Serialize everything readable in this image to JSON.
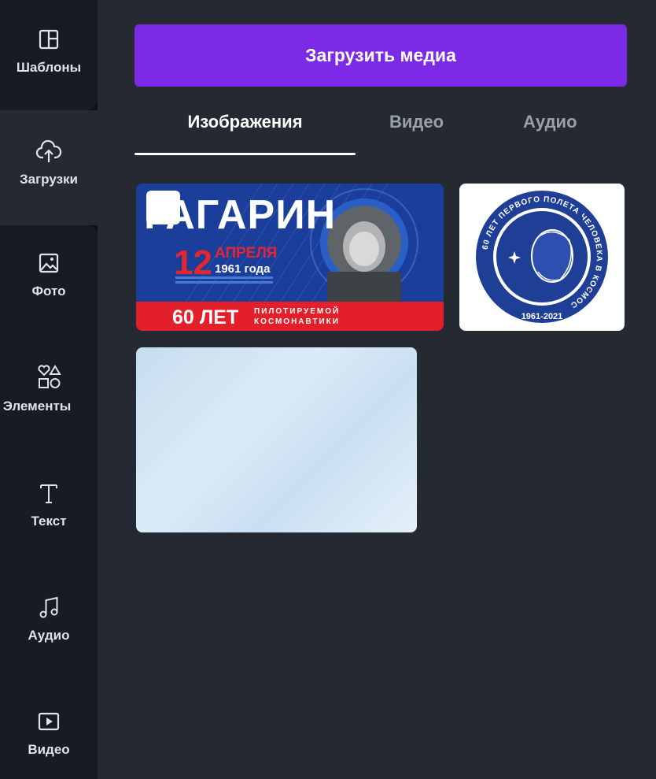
{
  "sidebar": {
    "items": [
      {
        "label": "Шаблоны",
        "icon": "layout-icon"
      },
      {
        "label": "Загрузки",
        "icon": "cloud-upload-icon"
      },
      {
        "label": "Фото",
        "icon": "image-icon"
      },
      {
        "label": "Элементы",
        "icon": "shapes-icon"
      },
      {
        "label": "Текст",
        "icon": "text-icon"
      },
      {
        "label": "Аудио",
        "icon": "music-note-icon"
      },
      {
        "label": "Видео",
        "icon": "video-play-icon"
      }
    ]
  },
  "panel": {
    "upload_button": "Загрузить медиа",
    "tabs": [
      {
        "label": "Изображения",
        "active": true
      },
      {
        "label": "Видео",
        "active": false
      },
      {
        "label": "Аудио",
        "active": false
      }
    ]
  },
  "thumbnails": {
    "poster": {
      "title": "ГАГАРИН",
      "day": "12",
      "month": "АПРЕЛЯ",
      "year": "1961 года",
      "years_label": "60 ЛЕТ",
      "subtitle_line1": "ПИЛОТИРУЕМОЙ",
      "subtitle_line2": "КОСМОНАВТИКИ"
    },
    "emblem": {
      "ring_text": "60 ЛЕТ ПЕРВОГО ПОЛЕТА ЧЕЛОВЕКА В КОСМОС",
      "years": "1961-2021"
    }
  },
  "colors": {
    "accent": "#7d2ae8",
    "sidebar_bg": "#0e1318",
    "panel_bg": "#252931",
    "poster_blue": "#1b3e9a",
    "poster_red": "#e21f2a"
  }
}
